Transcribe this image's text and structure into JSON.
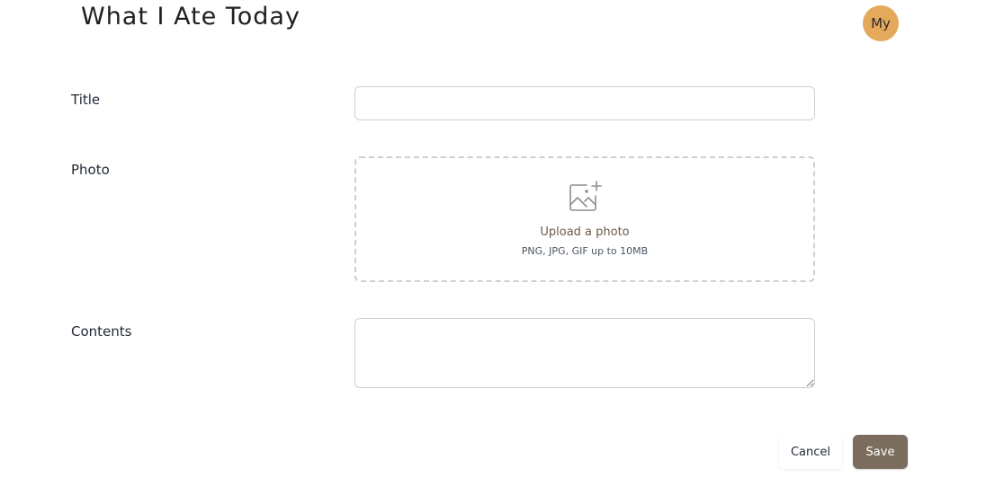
{
  "header": {
    "app_title": "What I Ate Today",
    "avatar_label": "My"
  },
  "form": {
    "title_label": "Title",
    "title_value": "",
    "photo_label": "Photo",
    "upload_text": "Upload a photo",
    "upload_hint": "PNG, JPG, GIF up to 10MB",
    "contents_label": "Contents",
    "contents_value": ""
  },
  "actions": {
    "cancel_label": "Cancel",
    "save_label": "Save"
  },
  "colors": {
    "avatar_bg": "#e5a95c",
    "save_bg": "#7c6e5e",
    "upload_text": "#6b5a48"
  },
  "icons": {
    "upload": "image-plus-icon"
  }
}
